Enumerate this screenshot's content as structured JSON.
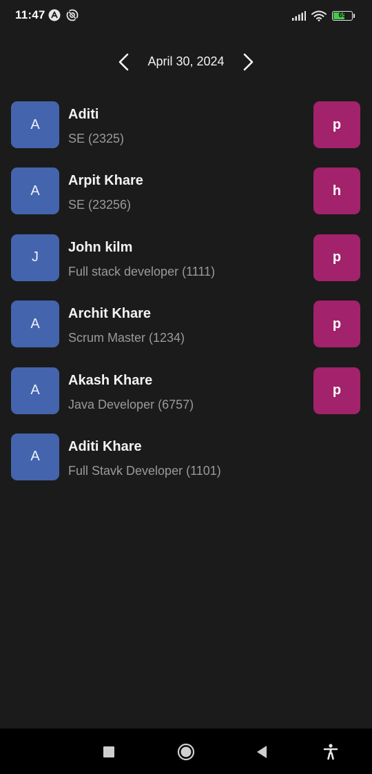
{
  "status_bar": {
    "time": "11:47",
    "battery_level": "65",
    "battery_fraction": 0.65,
    "icons": [
      "app-a-icon",
      "app-sync-icon",
      "signal-icon",
      "wifi-icon",
      "battery-icon"
    ],
    "battery_color": "#43c94a"
  },
  "date_nav": {
    "date": "April 30, 2024",
    "prev_icon": "chevron-left-icon",
    "next_icon": "chevron-right-icon"
  },
  "employees": [
    {
      "initial": "A",
      "name": "Aditi",
      "role": "SE (2325)",
      "status": "p"
    },
    {
      "initial": "A",
      "name": "Arpit Khare",
      "role": "SE (23256)",
      "status": "h"
    },
    {
      "initial": "J",
      "name": "John kilm",
      "role": "Full stack developer (1111)",
      "status": "p"
    },
    {
      "initial": "A",
      "name": "Archit Khare",
      "role": "Scrum Master (1234)",
      "status": "p"
    },
    {
      "initial": "A",
      "name": "Akash Khare",
      "role": "Java Developer (6757)",
      "status": "p"
    },
    {
      "initial": "A",
      "name": "Aditi Khare",
      "role": "Full Stavk Developer (1101)",
      "status": null
    }
  ],
  "nav_bar": {
    "buttons": [
      "recents-square-icon",
      "home-circle-icon",
      "back-triangle-icon",
      "accessibility-icon"
    ]
  },
  "colors": {
    "background": "#1b1b1b",
    "avatar": "#4464ad",
    "status_badge": "#a2226b",
    "secondary_text": "#9a9a9a"
  }
}
